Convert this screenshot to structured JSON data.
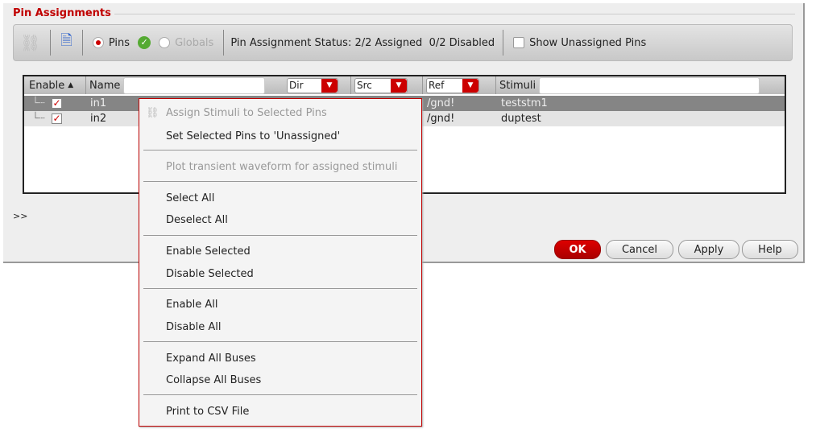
{
  "title": "Pin Assignments",
  "toolbar": {
    "pins": "Pins",
    "globals": "Globals",
    "status": "Pin Assignment Status: 2/2 Assigned  0/2 Disabled",
    "show_unassigned": "Show Unassigned Pins"
  },
  "table": {
    "headers": {
      "enable": "Enable",
      "name": "Name",
      "dir": "Dir",
      "src": "Src",
      "ref": "Ref",
      "stimuli": "Stimuli"
    },
    "rows": [
      {
        "name": "in1",
        "ref": "/gnd!",
        "stimuli": "teststm1"
      },
      {
        "name": "in2",
        "ref": "/gnd!",
        "stimuli": "duptest"
      }
    ]
  },
  "expand": ">>",
  "buttons": {
    "ok": "OK",
    "cancel": "Cancel",
    "apply": "Apply",
    "help": "Help"
  },
  "menu": [
    "Assign Stimuli to Selected Pins",
    "Set Selected Pins to 'Unassigned'",
    "Plot transient waveform for assigned stimuli",
    "Select All",
    "Deselect All",
    "Enable Selected",
    "Disable Selected",
    "Enable All",
    "Disable All",
    "Expand All Buses",
    "Collapse All Buses",
    "Print to CSV File"
  ]
}
